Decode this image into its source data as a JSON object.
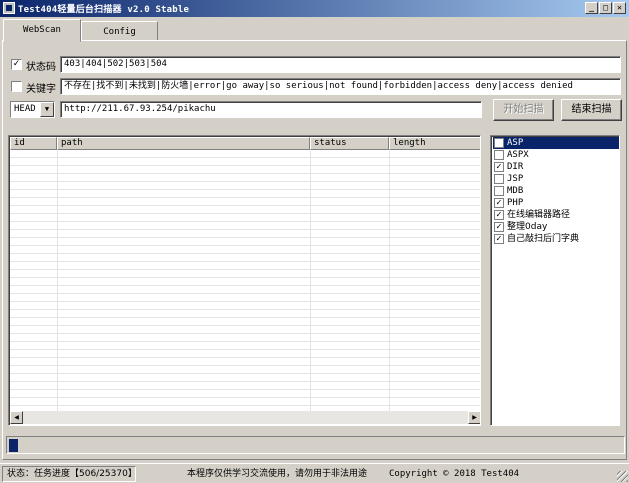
{
  "window": {
    "title": "Test404轻量后台扫描器 v2.0 Stable",
    "minimize": "_",
    "maximize": "□",
    "close": "✕"
  },
  "tabs": [
    {
      "label": "WebScan",
      "active": true
    },
    {
      "label": "Config",
      "active": false
    }
  ],
  "status_filter": {
    "checked": true,
    "check_mark": "✓",
    "label": "状态码",
    "value": "403|404|502|503|504"
  },
  "keyword_filter": {
    "checked": false,
    "label": "关键字",
    "value": "不存在|找不到|未找到|防火墙|error|go away|so serious|not found|forbidden|access deny|access denied"
  },
  "request": {
    "method": "HEAD",
    "url": "http://211.67.93.254/pikachu"
  },
  "buttons": {
    "start": "开始扫描",
    "stop": "结束扫描"
  },
  "results_table": {
    "columns": [
      "id",
      "path",
      "status",
      "length"
    ],
    "rows": []
  },
  "dictionaries": [
    {
      "label": "ASP",
      "checked": false,
      "selected": true
    },
    {
      "label": "ASPX",
      "checked": false,
      "selected": false
    },
    {
      "label": "DIR",
      "checked": true,
      "selected": false
    },
    {
      "label": "JSP",
      "checked": false,
      "selected": false
    },
    {
      "label": "MDB",
      "checked": false,
      "selected": false
    },
    {
      "label": "PHP",
      "checked": true,
      "selected": false
    },
    {
      "label": "在线编辑器路径",
      "checked": true,
      "selected": false
    },
    {
      "label": "整理0day",
      "checked": true,
      "selected": false
    },
    {
      "label": "自己敲扫后门字典",
      "checked": true,
      "selected": false
    }
  ],
  "progress": {
    "done": 506,
    "total": 25370
  },
  "statusbar": {
    "status": "状态：任务进度【506/25370】",
    "notice": "本程序仅供学习交流使用，请勿用于非法用途",
    "copyright": "Copyright ©  2018 Test404"
  },
  "colors": {
    "face": "#d4d0c8",
    "title_start": "#0a246a",
    "title_end": "#a6caf0",
    "selection": "#0a246a"
  }
}
